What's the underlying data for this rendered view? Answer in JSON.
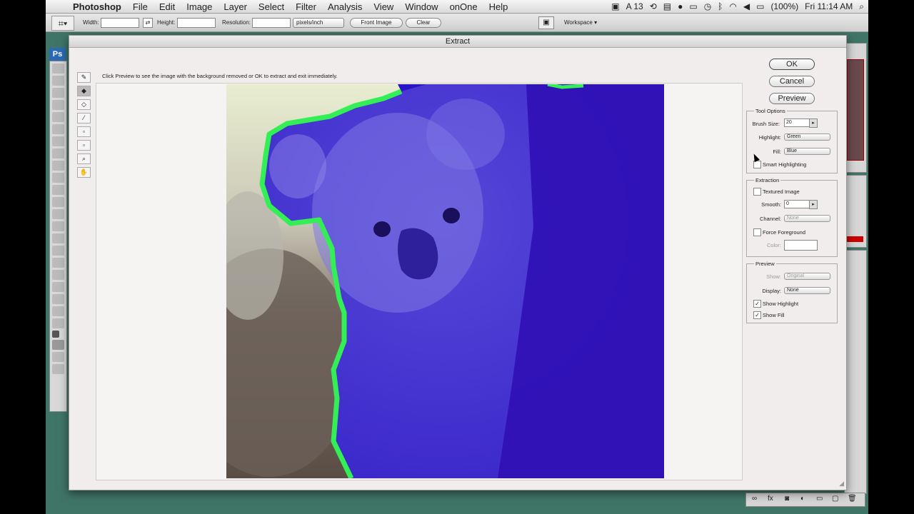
{
  "menubar": {
    "app": "Photoshop",
    "items": [
      "File",
      "Edit",
      "Image",
      "Layer",
      "Select",
      "Filter",
      "Analysis",
      "View",
      "Window",
      "onOne",
      "Help"
    ],
    "status": {
      "adobe_count": "13",
      "battery": "(100%)",
      "clock": "Fri 11:14 AM"
    }
  },
  "options_bar": {
    "width_label": "Width:",
    "height_label": "Height:",
    "resolution_label": "Resolution:",
    "units_value": "pixels/inch",
    "front_image_label": "Front Image",
    "clear_label": "Clear",
    "workspace_label": "Workspace"
  },
  "ps_logo": "Ps",
  "dialog": {
    "title": "Extract",
    "hint": "Click Preview to see the image with the background removed or OK to extract and exit immediately.",
    "buttons": {
      "ok": "OK",
      "cancel": "Cancel",
      "preview": "Preview"
    },
    "tool_options": {
      "title": "Tool Options",
      "brush_size_label": "Brush Size:",
      "brush_size_value": "20",
      "highlight_label": "Highlight:",
      "highlight_value": "Green",
      "fill_label": "Fill:",
      "fill_value": "Blue",
      "smart_highlighting_label": "Smart Highlighting",
      "smart_highlighting_checked": false
    },
    "extraction": {
      "title": "Extraction",
      "textured_image_label": "Textured Image",
      "textured_image_checked": false,
      "smooth_label": "Smooth:",
      "smooth_value": "0",
      "channel_label": "Channel:",
      "channel_value": "None",
      "force_foreground_label": "Force Foreground",
      "force_foreground_checked": false,
      "color_label": "Color:"
    },
    "preview_group": {
      "title": "Preview",
      "show_label": "Show:",
      "show_value": "Original",
      "display_label": "Display:",
      "display_value": "None",
      "show_highlight_label": "Show Highlight",
      "show_highlight_checked": true,
      "show_fill_label": "Show Fill",
      "show_fill_checked": true
    }
  },
  "colors": {
    "highlight": "#33ee55",
    "fill": "#2a14c8",
    "desktop": "#3f7567"
  }
}
